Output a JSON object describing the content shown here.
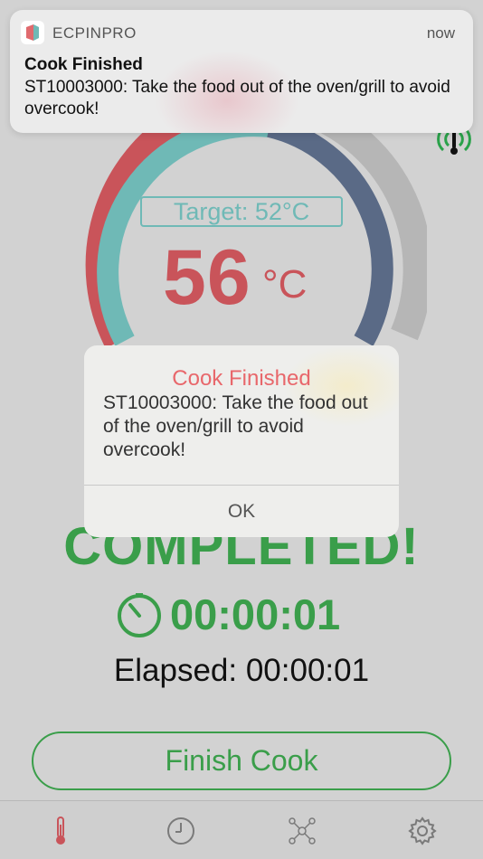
{
  "notification": {
    "app_name": "ECPINPRO",
    "time": "now",
    "title": "Cook Finished",
    "body": "ST10003000: Take the food out of the oven/grill to avoid overcook!"
  },
  "gauge": {
    "target_label": "Target: 52°C",
    "temperature": "56",
    "unit": "°C"
  },
  "status": {
    "completed": "COMPLETED!",
    "timer": "00:00:01",
    "elapsed": "Elapsed: 00:00:01"
  },
  "actions": {
    "finish_label": "Finish Cook"
  },
  "alert": {
    "title": "Cook Finished",
    "message": "ST10003000: Take the food out of the oven/grill to avoid overcook!",
    "ok_label": "OK"
  },
  "tabbar": {
    "tabs": [
      {
        "icon": "thermometer-icon",
        "active": true
      },
      {
        "icon": "clock-icon",
        "active": false
      },
      {
        "icon": "network-icon",
        "active": false
      },
      {
        "icon": "gear-icon",
        "active": false
      }
    ]
  },
  "colors": {
    "accent_red": "#c9545a",
    "accent_teal": "#6fb9b6",
    "accent_blue": "#5a6a86",
    "accent_green": "#3a9e4a",
    "alert_title": "#e8676b"
  }
}
